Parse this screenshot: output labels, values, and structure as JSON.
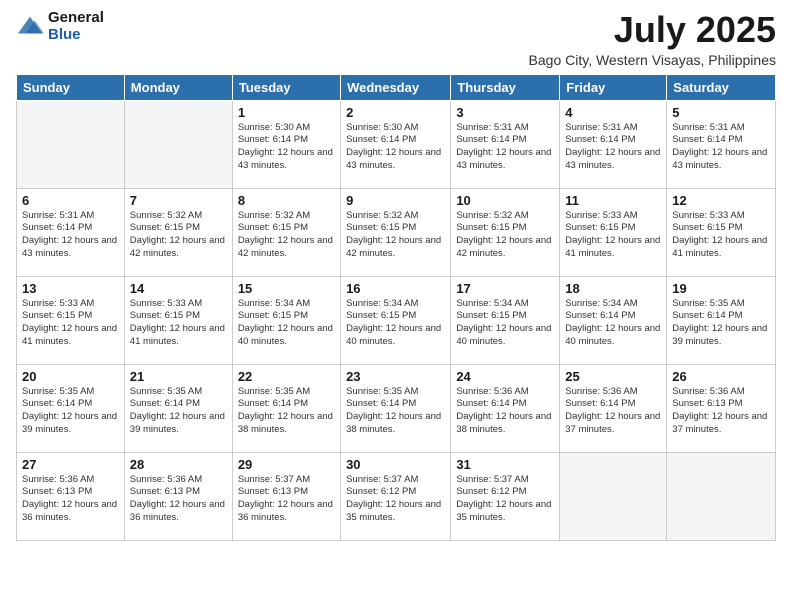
{
  "header": {
    "logo_general": "General",
    "logo_blue": "Blue",
    "main_title": "July 2025",
    "subtitle": "Bago City, Western Visayas, Philippines"
  },
  "days_of_week": [
    "Sunday",
    "Monday",
    "Tuesday",
    "Wednesday",
    "Thursday",
    "Friday",
    "Saturday"
  ],
  "weeks": [
    [
      {
        "day": "",
        "info": ""
      },
      {
        "day": "",
        "info": ""
      },
      {
        "day": "1",
        "info": "Sunrise: 5:30 AM\nSunset: 6:14 PM\nDaylight: 12 hours and 43 minutes."
      },
      {
        "day": "2",
        "info": "Sunrise: 5:30 AM\nSunset: 6:14 PM\nDaylight: 12 hours and 43 minutes."
      },
      {
        "day": "3",
        "info": "Sunrise: 5:31 AM\nSunset: 6:14 PM\nDaylight: 12 hours and 43 minutes."
      },
      {
        "day": "4",
        "info": "Sunrise: 5:31 AM\nSunset: 6:14 PM\nDaylight: 12 hours and 43 minutes."
      },
      {
        "day": "5",
        "info": "Sunrise: 5:31 AM\nSunset: 6:14 PM\nDaylight: 12 hours and 43 minutes."
      }
    ],
    [
      {
        "day": "6",
        "info": "Sunrise: 5:31 AM\nSunset: 6:14 PM\nDaylight: 12 hours and 43 minutes."
      },
      {
        "day": "7",
        "info": "Sunrise: 5:32 AM\nSunset: 6:15 PM\nDaylight: 12 hours and 42 minutes."
      },
      {
        "day": "8",
        "info": "Sunrise: 5:32 AM\nSunset: 6:15 PM\nDaylight: 12 hours and 42 minutes."
      },
      {
        "day": "9",
        "info": "Sunrise: 5:32 AM\nSunset: 6:15 PM\nDaylight: 12 hours and 42 minutes."
      },
      {
        "day": "10",
        "info": "Sunrise: 5:32 AM\nSunset: 6:15 PM\nDaylight: 12 hours and 42 minutes."
      },
      {
        "day": "11",
        "info": "Sunrise: 5:33 AM\nSunset: 6:15 PM\nDaylight: 12 hours and 41 minutes."
      },
      {
        "day": "12",
        "info": "Sunrise: 5:33 AM\nSunset: 6:15 PM\nDaylight: 12 hours and 41 minutes."
      }
    ],
    [
      {
        "day": "13",
        "info": "Sunrise: 5:33 AM\nSunset: 6:15 PM\nDaylight: 12 hours and 41 minutes."
      },
      {
        "day": "14",
        "info": "Sunrise: 5:33 AM\nSunset: 6:15 PM\nDaylight: 12 hours and 41 minutes."
      },
      {
        "day": "15",
        "info": "Sunrise: 5:34 AM\nSunset: 6:15 PM\nDaylight: 12 hours and 40 minutes."
      },
      {
        "day": "16",
        "info": "Sunrise: 5:34 AM\nSunset: 6:15 PM\nDaylight: 12 hours and 40 minutes."
      },
      {
        "day": "17",
        "info": "Sunrise: 5:34 AM\nSunset: 6:15 PM\nDaylight: 12 hours and 40 minutes."
      },
      {
        "day": "18",
        "info": "Sunrise: 5:34 AM\nSunset: 6:14 PM\nDaylight: 12 hours and 40 minutes."
      },
      {
        "day": "19",
        "info": "Sunrise: 5:35 AM\nSunset: 6:14 PM\nDaylight: 12 hours and 39 minutes."
      }
    ],
    [
      {
        "day": "20",
        "info": "Sunrise: 5:35 AM\nSunset: 6:14 PM\nDaylight: 12 hours and 39 minutes."
      },
      {
        "day": "21",
        "info": "Sunrise: 5:35 AM\nSunset: 6:14 PM\nDaylight: 12 hours and 39 minutes."
      },
      {
        "day": "22",
        "info": "Sunrise: 5:35 AM\nSunset: 6:14 PM\nDaylight: 12 hours and 38 minutes."
      },
      {
        "day": "23",
        "info": "Sunrise: 5:35 AM\nSunset: 6:14 PM\nDaylight: 12 hours and 38 minutes."
      },
      {
        "day": "24",
        "info": "Sunrise: 5:36 AM\nSunset: 6:14 PM\nDaylight: 12 hours and 38 minutes."
      },
      {
        "day": "25",
        "info": "Sunrise: 5:36 AM\nSunset: 6:14 PM\nDaylight: 12 hours and 37 minutes."
      },
      {
        "day": "26",
        "info": "Sunrise: 5:36 AM\nSunset: 6:13 PM\nDaylight: 12 hours and 37 minutes."
      }
    ],
    [
      {
        "day": "27",
        "info": "Sunrise: 5:36 AM\nSunset: 6:13 PM\nDaylight: 12 hours and 36 minutes."
      },
      {
        "day": "28",
        "info": "Sunrise: 5:36 AM\nSunset: 6:13 PM\nDaylight: 12 hours and 36 minutes."
      },
      {
        "day": "29",
        "info": "Sunrise: 5:37 AM\nSunset: 6:13 PM\nDaylight: 12 hours and 36 minutes."
      },
      {
        "day": "30",
        "info": "Sunrise: 5:37 AM\nSunset: 6:12 PM\nDaylight: 12 hours and 35 minutes."
      },
      {
        "day": "31",
        "info": "Sunrise: 5:37 AM\nSunset: 6:12 PM\nDaylight: 12 hours and 35 minutes."
      },
      {
        "day": "",
        "info": ""
      },
      {
        "day": "",
        "info": ""
      }
    ]
  ]
}
